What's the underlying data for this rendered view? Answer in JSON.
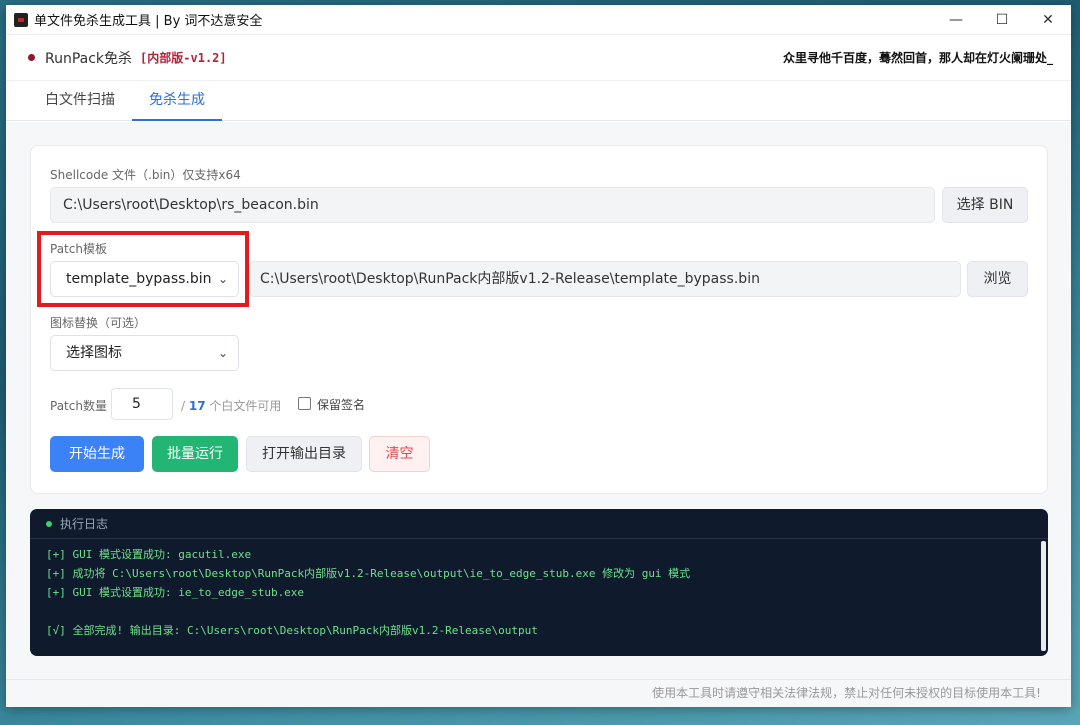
{
  "window": {
    "title": "单文件免杀生成工具 | By 词不达意安全",
    "controls": {
      "minimize": "—",
      "maximize": "☐",
      "close": "✕"
    }
  },
  "header": {
    "brand": "RunPack免杀",
    "version": "[内部版-v1.2]",
    "quote": "众里寻他千百度，蓦然回首，那人却在灯火阑珊处_",
    "accent_color": "#8b1a2b"
  },
  "tabs": [
    {
      "label": "白文件扫描",
      "active": false
    },
    {
      "label": "免杀生成",
      "active": true
    }
  ],
  "form": {
    "shellcode": {
      "label": "Shellcode 文件（.bin）仅支持x64",
      "value": "C:\\Users\\root\\Desktop\\rs_beacon.bin",
      "button": "选择 BIN"
    },
    "patch": {
      "label": "Patch模板",
      "selected": "template_bypass.bin",
      "path": "C:\\Users\\root\\Desktop\\RunPack内部版v1.2-Release\\template_bypass.bin",
      "button": "浏览"
    },
    "icon": {
      "label": "图标替换（可选）",
      "selected": "选择图标"
    },
    "patch_count": {
      "label": "Patch数量",
      "value": "5",
      "prefix": "/",
      "total": "17",
      "suffix": "个白文件可用"
    },
    "keep_signature": {
      "label": "保留签名",
      "checked": false
    },
    "actions": {
      "start": "开始生成",
      "batch": "批量运行",
      "open_output": "打开输出目录",
      "clear": "清空"
    }
  },
  "log": {
    "title": "执行日志",
    "lines": [
      "[+] GUI 模式设置成功: gacutil.exe",
      "[+] 成功将 C:\\Users\\root\\Desktop\\RunPack内部版v1.2-Release\\output\\ie_to_edge_stub.exe 修改为 gui 模式",
      "[+] GUI 模式设置成功: ie_to_edge_stub.exe",
      "",
      "[√] 全部完成! 输出目录: C:\\Users\\root\\Desktop\\RunPack内部版v1.2-Release\\output"
    ]
  },
  "footer": {
    "notice": "使用本工具时请遵守相关法律法规，禁止对任何未授权的目标使用本工具!"
  },
  "colors": {
    "primary": "#3b82f6",
    "success": "#22b573",
    "danger": "#e5484d",
    "log_bg": "#0f1b2d",
    "log_text": "#6fe08a",
    "highlight": "#e21c1c"
  }
}
